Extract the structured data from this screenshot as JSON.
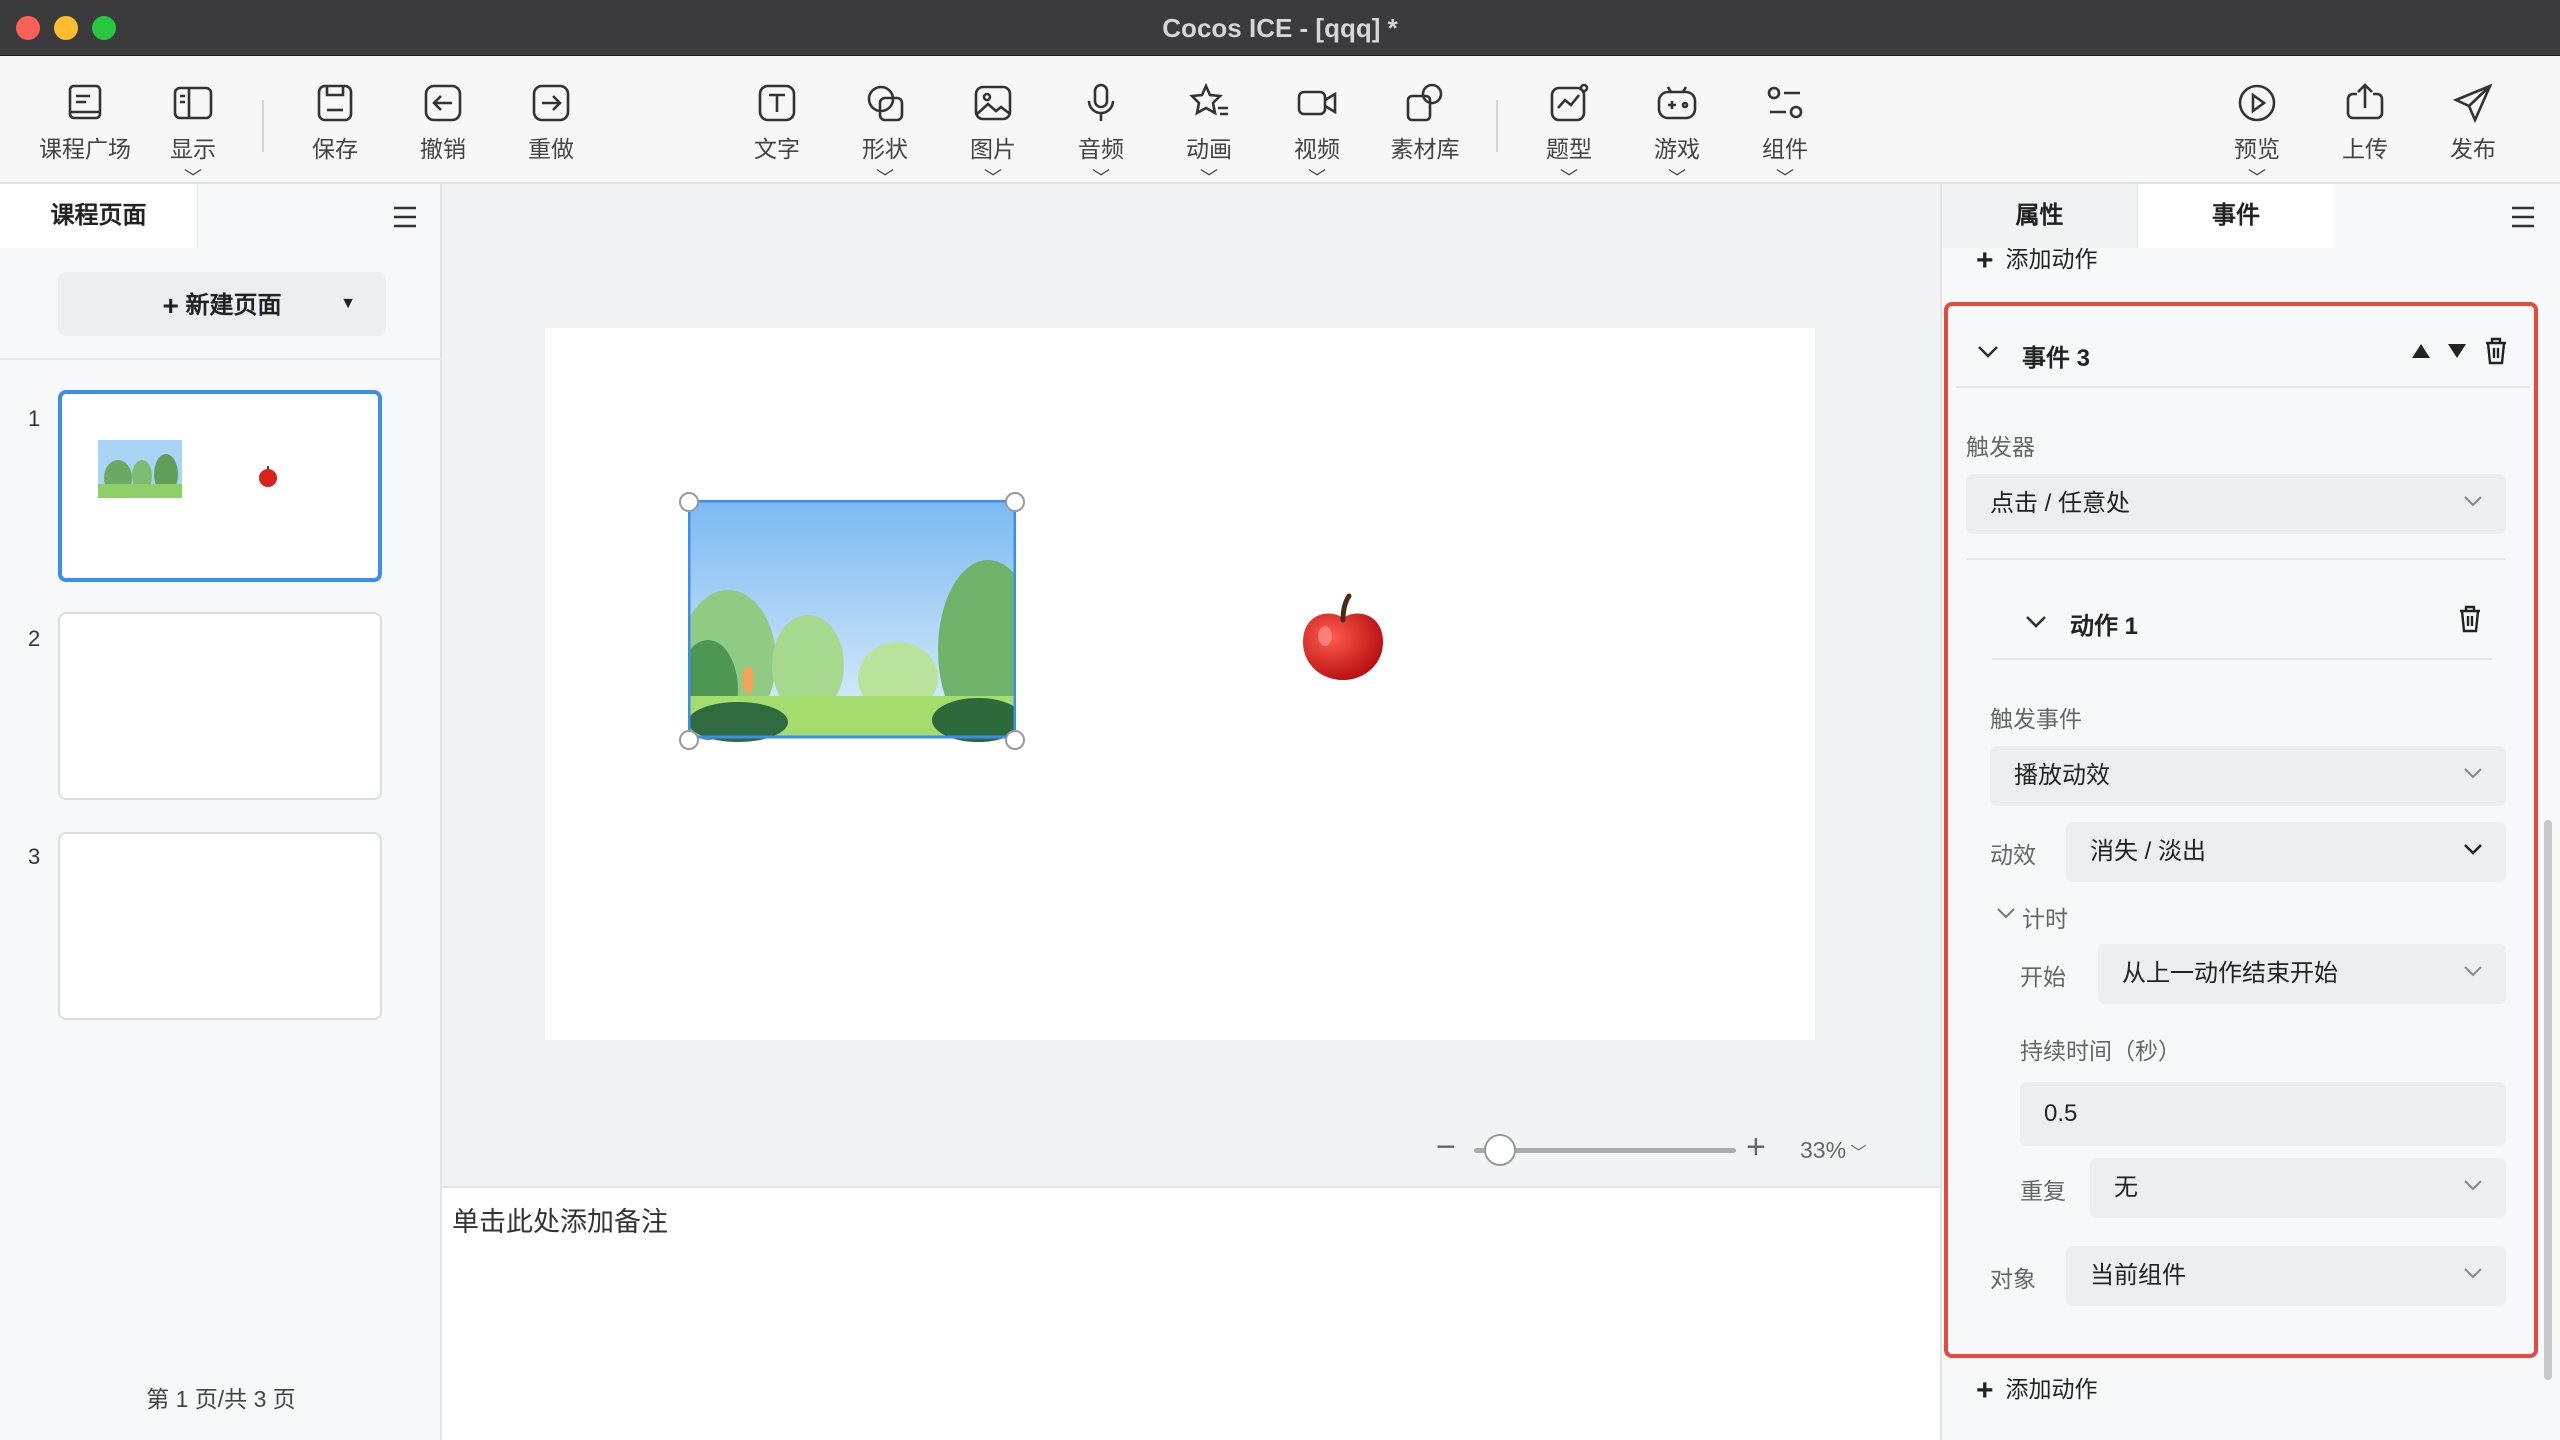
{
  "window": {
    "title": "Cocos ICE - [qqq] *"
  },
  "toolbar": {
    "course_square": "课程广场",
    "display": "显示",
    "save": "保存",
    "undo": "撤销",
    "redo": "重做",
    "text": "文字",
    "shape": "形状",
    "image": "图片",
    "audio": "音频",
    "animation": "动画",
    "video": "视频",
    "assets": "素材库",
    "question": "题型",
    "game": "游戏",
    "component": "组件",
    "preview": "预览",
    "upload": "上传",
    "publish": "发布"
  },
  "left_panel": {
    "tab": "课程页面",
    "new_page": "新建页面",
    "pages": [
      "1",
      "2",
      "3"
    ],
    "page_info": "第 1 页/共 3 页"
  },
  "canvas": {
    "zoom_minus": "−",
    "zoom_plus": "+",
    "zoom_level": "33%",
    "zoom_fraction": 0.1
  },
  "notes": {
    "placeholder": "单击此处添加备注"
  },
  "right_panel": {
    "tab_properties": "属性",
    "tab_events": "事件",
    "add_action_top": "添加动作",
    "event_title": "事件 3",
    "trigger_label": "触发器",
    "trigger_value": "点击 / 任意处",
    "action_title": "动作 1",
    "trigger_event_label": "触发事件",
    "trigger_event_value": "播放动效",
    "effect_label": "动效",
    "effect_value": "消失 / 淡出",
    "timing_label": "计时",
    "start_label": "开始",
    "start_value": "从上一动作结束开始",
    "duration_label": "持续时间（秒）",
    "duration_value": "0.5",
    "repeat_label": "重复",
    "repeat_value": "无",
    "target_label": "对象",
    "target_value": "当前组件",
    "add_action_bottom": "添加动作"
  },
  "colors": {
    "accent": "#3c8df0",
    "highlight": "#e5483c"
  }
}
